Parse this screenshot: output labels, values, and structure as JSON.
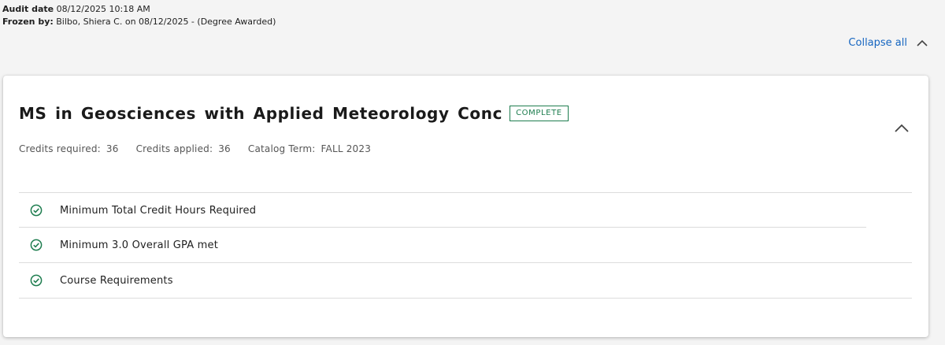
{
  "audit": {
    "audit_date_label": "Audit date",
    "audit_date_value": "08/12/2025 10:18 AM",
    "frozen_by_label": "Frozen by:",
    "frozen_by_value": "Bilbo, Shiera C. on 08/12/2025 - (Degree Awarded)"
  },
  "toolbar": {
    "collapse_all_label": "Collapse all"
  },
  "degree": {
    "title": "MS in Geosciences with Applied Meteorology Conc",
    "status": "COMPLETE",
    "credits_required_label": "Credits required:",
    "credits_required_value": "36",
    "credits_applied_label": "Credits applied:",
    "credits_applied_value": "36",
    "catalog_term_label": "Catalog Term:",
    "catalog_term_value": "FALL 2023"
  },
  "requirements": [
    {
      "label": "Minimum Total Credit Hours Required",
      "status_icon": "check-circle-icon"
    },
    {
      "label": "Minimum 3.0 Overall GPA met",
      "status_icon": "check-circle-icon"
    },
    {
      "label": "Course Requirements",
      "status_icon": "check-circle-icon"
    }
  ],
  "colors": {
    "accent_link": "#1565c0",
    "complete_green": "#1e7d4f"
  }
}
